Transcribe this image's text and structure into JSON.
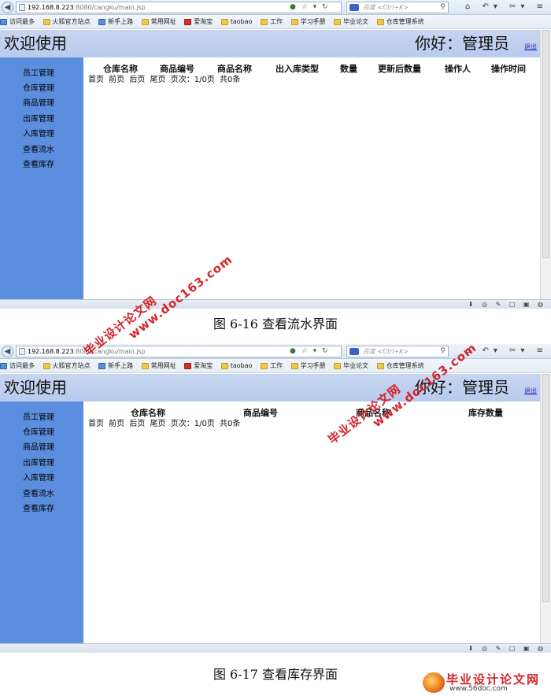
{
  "browser": {
    "url_host": "192.168.8.223",
    "url_path": ":8080/cangku/main.jsp",
    "search_placeholder": "百度 <Ctrl+K>"
  },
  "bookmarks": [
    "访问最多",
    "火狐官方站点",
    "新手上路",
    "常用网址",
    "爱淘宝",
    "taobao",
    "工作",
    "学习手册",
    "毕业论文",
    "仓库管理系统"
  ],
  "header": {
    "welcome": "欢迎使用",
    "greeting": "你好：管理员",
    "logout": "退出"
  },
  "sidebar": {
    "items": [
      "员工管理",
      "仓库管理",
      "商品管理",
      "出库管理",
      "入库管理",
      "查看流水",
      "查看库存"
    ]
  },
  "screen1": {
    "columns": [
      "仓库名称",
      "商品编号",
      "商品名称",
      "出入库类型",
      "数量",
      "更新后数量",
      "操作人",
      "操作时间"
    ],
    "pager": "首页 前页 后页 尾页 页次：1/0页 共0条",
    "caption": "图 6-16  查看流水界面"
  },
  "screen2": {
    "columns": [
      "仓库名称",
      "商品编号",
      "商品名称",
      "库存数量"
    ],
    "pager": "首页 前页 后页 尾页 页次：1/0页 共0条",
    "caption": "图 6-17  查看库存界面"
  },
  "watermark": {
    "line1": "毕业设计论文网",
    "line2": "www.doc163.com",
    "logo_text": "毕业设计论文网",
    "logo_url": "www.56doc.com",
    "color": "#d4242a"
  }
}
